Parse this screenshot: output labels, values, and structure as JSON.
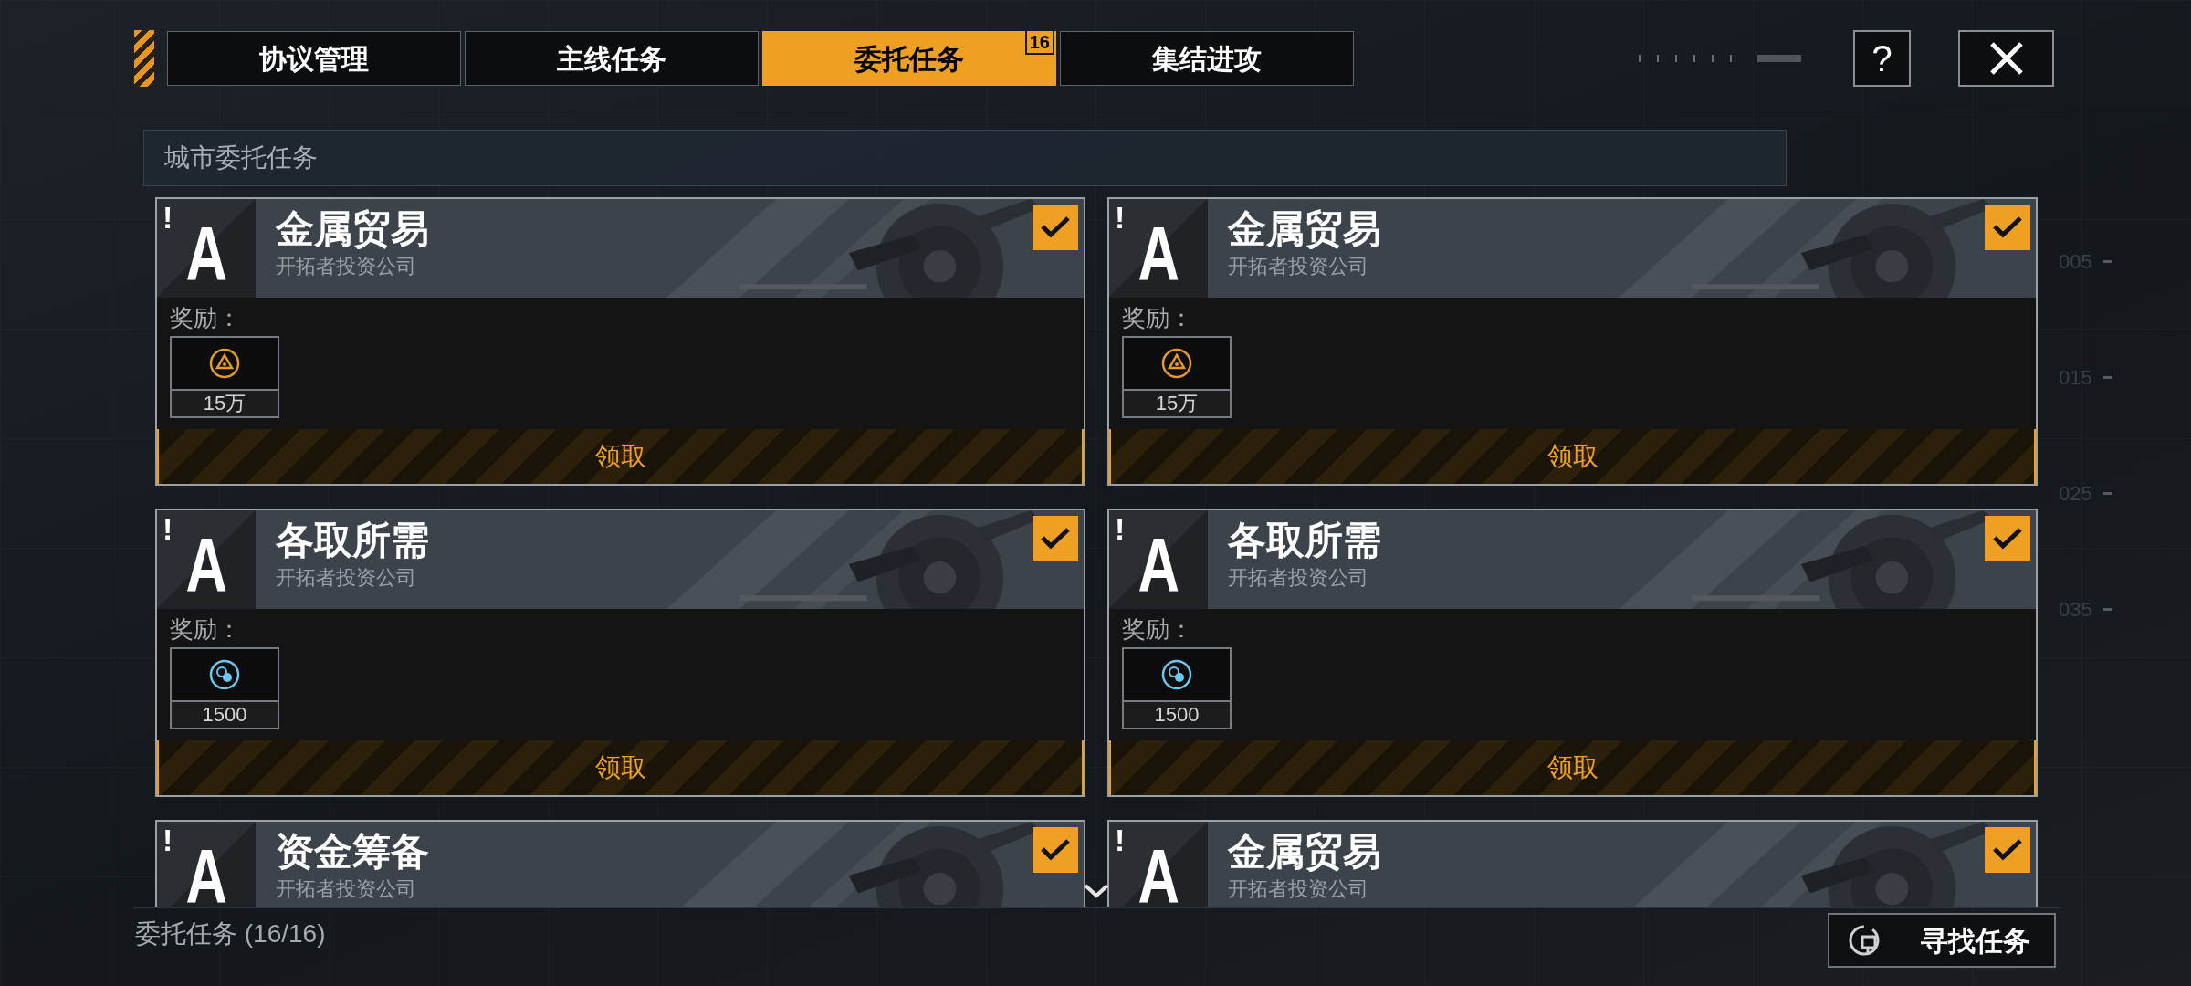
{
  "tabs": [
    {
      "label": "协议管理",
      "selected": false
    },
    {
      "label": "主线任务",
      "selected": false
    },
    {
      "label": "委托任务",
      "selected": true,
      "badge": "16"
    },
    {
      "label": "集结进攻",
      "selected": false
    }
  ],
  "help_button": "?",
  "section_title": "城市委托任务",
  "scale_labels": [
    "005",
    "015",
    "025",
    "035"
  ],
  "quests": [
    {
      "alert": "!",
      "grade": "A",
      "title": "金属贸易",
      "company": "开拓者投资公司",
      "checked": true,
      "reward_label": "奖励：",
      "rewards": [
        {
          "kind": "coin",
          "amount": "15万"
        }
      ],
      "claim_label": "领取"
    },
    {
      "alert": "!",
      "grade": "A",
      "title": "金属贸易",
      "company": "开拓者投资公司",
      "checked": true,
      "reward_label": "奖励：",
      "rewards": [
        {
          "kind": "coin",
          "amount": "15万"
        }
      ],
      "claim_label": "领取"
    },
    {
      "alert": "!",
      "grade": "A",
      "title": "各取所需",
      "company": "开拓者投资公司",
      "checked": true,
      "reward_label": "奖励：",
      "rewards": [
        {
          "kind": "orb",
          "amount": "1500"
        }
      ],
      "claim_label": "领取"
    },
    {
      "alert": "!",
      "grade": "A",
      "title": "各取所需",
      "company": "开拓者投资公司",
      "checked": true,
      "reward_label": "奖励：",
      "rewards": [
        {
          "kind": "orb",
          "amount": "1500"
        }
      ],
      "claim_label": "领取"
    },
    {
      "alert": "!",
      "grade": "A",
      "title": "资金筹备",
      "company": "开拓者投资公司",
      "checked": true
    },
    {
      "alert": "!",
      "grade": "A",
      "title": "金属贸易",
      "company": "开拓者投资公司",
      "checked": true
    }
  ],
  "footer": {
    "count": "委托任务 (16/16)",
    "find_button": "寻找任务"
  }
}
